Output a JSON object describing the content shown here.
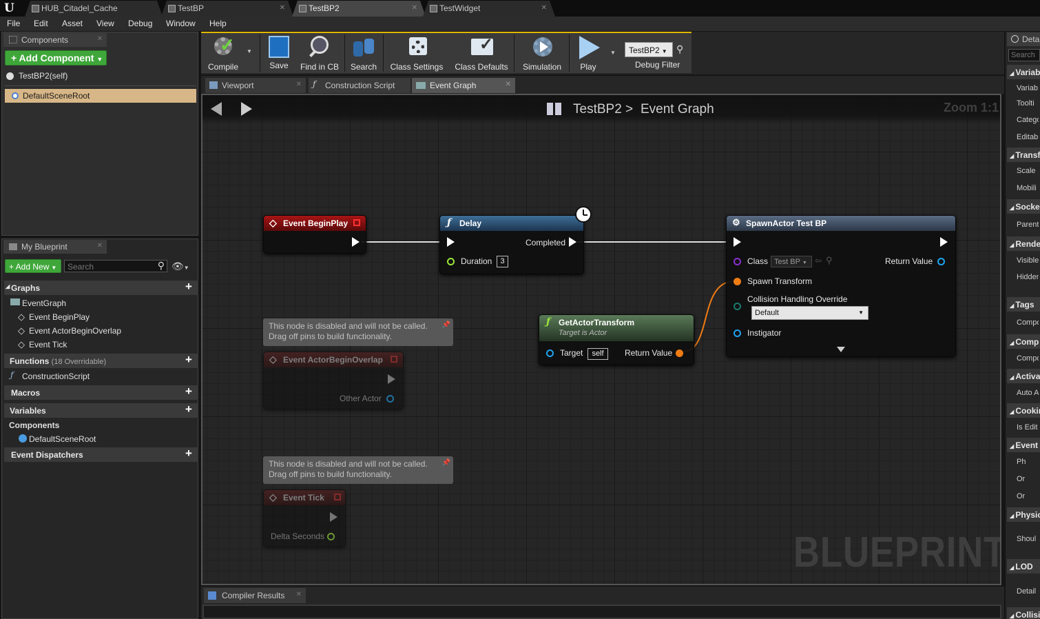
{
  "app": {
    "logo": "unreal-engine-logo"
  },
  "tabs": [
    {
      "label": "HUB_Citadel_Cache"
    },
    {
      "label": "TestBP"
    },
    {
      "label": "TestBP2"
    },
    {
      "label": "TestWidget"
    }
  ],
  "menu": [
    "File",
    "Edit",
    "Asset",
    "View",
    "Debug",
    "Window",
    "Help"
  ],
  "components_panel": {
    "tab_label": "Components",
    "add_button": "+ Add Component",
    "self_item": "TestBP2(self)",
    "root_item": "DefaultSceneRoot"
  },
  "my_blueprint": {
    "tab_label": "My Blueprint",
    "add_new": "+ Add New",
    "search_placeholder": "Search",
    "sections": {
      "graphs": "Graphs",
      "event_graph": "EventGraph",
      "events": [
        "Event BeginPlay",
        "Event ActorBeginOverlap",
        "Event Tick"
      ],
      "functions": "Functions",
      "functions_note": "(18 Overridable)",
      "construction_script": "ConstructionScript",
      "macros": "Macros",
      "variables": "Variables",
      "components": "Components",
      "default_scene_root": "DefaultSceneRoot",
      "event_dispatchers": "Event Dispatchers"
    }
  },
  "toolbar": {
    "compile": "Compile",
    "save": "Save",
    "find_in_cb": "Find in CB",
    "search": "Search",
    "class_settings": "Class Settings",
    "class_defaults": "Class Defaults",
    "simulation": "Simulation",
    "play": "Play",
    "debug_select": "TestBP2",
    "debug_filter": "Debug Filter"
  },
  "editor_tabs": [
    {
      "label": "Viewport"
    },
    {
      "label": "Construction Script"
    },
    {
      "label": "Event Graph"
    }
  ],
  "graph": {
    "breadcrumb_bp": "TestBP2",
    "breadcrumb_sep": ">",
    "breadcrumb_graph": "Event Graph",
    "zoom": "Zoom 1:1",
    "watermark": "BLUEPRINT",
    "nodes": {
      "begin_play": {
        "title": "Event BeginPlay"
      },
      "delay": {
        "title": "Delay",
        "completed": "Completed",
        "duration_label": "Duration",
        "duration_value": "3"
      },
      "spawn": {
        "title": "SpawnActor Test BP",
        "class_label": "Class",
        "class_value": "Test BP",
        "return_value": "Return Value",
        "spawn_transform": "Spawn Transform",
        "collision": "Collision Handling Override",
        "collision_value": "Default",
        "instigator": "Instigator"
      },
      "get_transform": {
        "title": "GetActorTransform",
        "subtitle": "Target is Actor",
        "target": "Target",
        "target_value": "self",
        "return_value": "Return Value"
      },
      "overlap": {
        "title": "Event ActorBeginOverlap",
        "pin": "Other Actor"
      },
      "tick": {
        "title": "Event Tick",
        "pin": "Delta Seconds"
      }
    },
    "disabled_note": "This node is disabled and will not be called.\nDrag off pins to build functionality."
  },
  "compiler_results": {
    "tab_label": "Compiler Results"
  },
  "details": {
    "tab_label": "Deta",
    "search_placeholder": "Search",
    "sections": [
      {
        "label": "Variab",
        "rows": [
          "Variab",
          "Toolti",
          "Catego",
          "Editab"
        ]
      },
      {
        "label": "Transf",
        "rows": [
          "Scale",
          "Mobili"
        ]
      },
      {
        "label": "Socke",
        "rows": [
          "Parent"
        ]
      },
      {
        "label": "Rende",
        "rows": [
          "Visible",
          "Hidden"
        ]
      },
      {
        "label": "Tags",
        "rows": [
          "Compo"
        ]
      },
      {
        "label": "Comp",
        "rows": [
          "Compo"
        ]
      },
      {
        "label": "Activa",
        "rows": [
          "Auto A"
        ]
      },
      {
        "label": "Cookin",
        "rows": [
          "Is Edit"
        ]
      },
      {
        "label": "Event",
        "rows": [
          "Ph",
          "Or",
          "Or"
        ]
      },
      {
        "label": "Physic",
        "rows": [
          "Shoul"
        ]
      },
      {
        "label": "LOD",
        "rows": [
          "Detail"
        ]
      },
      {
        "label": "Collisi",
        "rows": []
      }
    ]
  },
  "colors": {
    "accent_green": "#3fa73a",
    "event_red": "#8a1010",
    "function_blue": "#2b4d6b",
    "pure_green": "#3d5c3d",
    "selection": "#d7b687"
  }
}
